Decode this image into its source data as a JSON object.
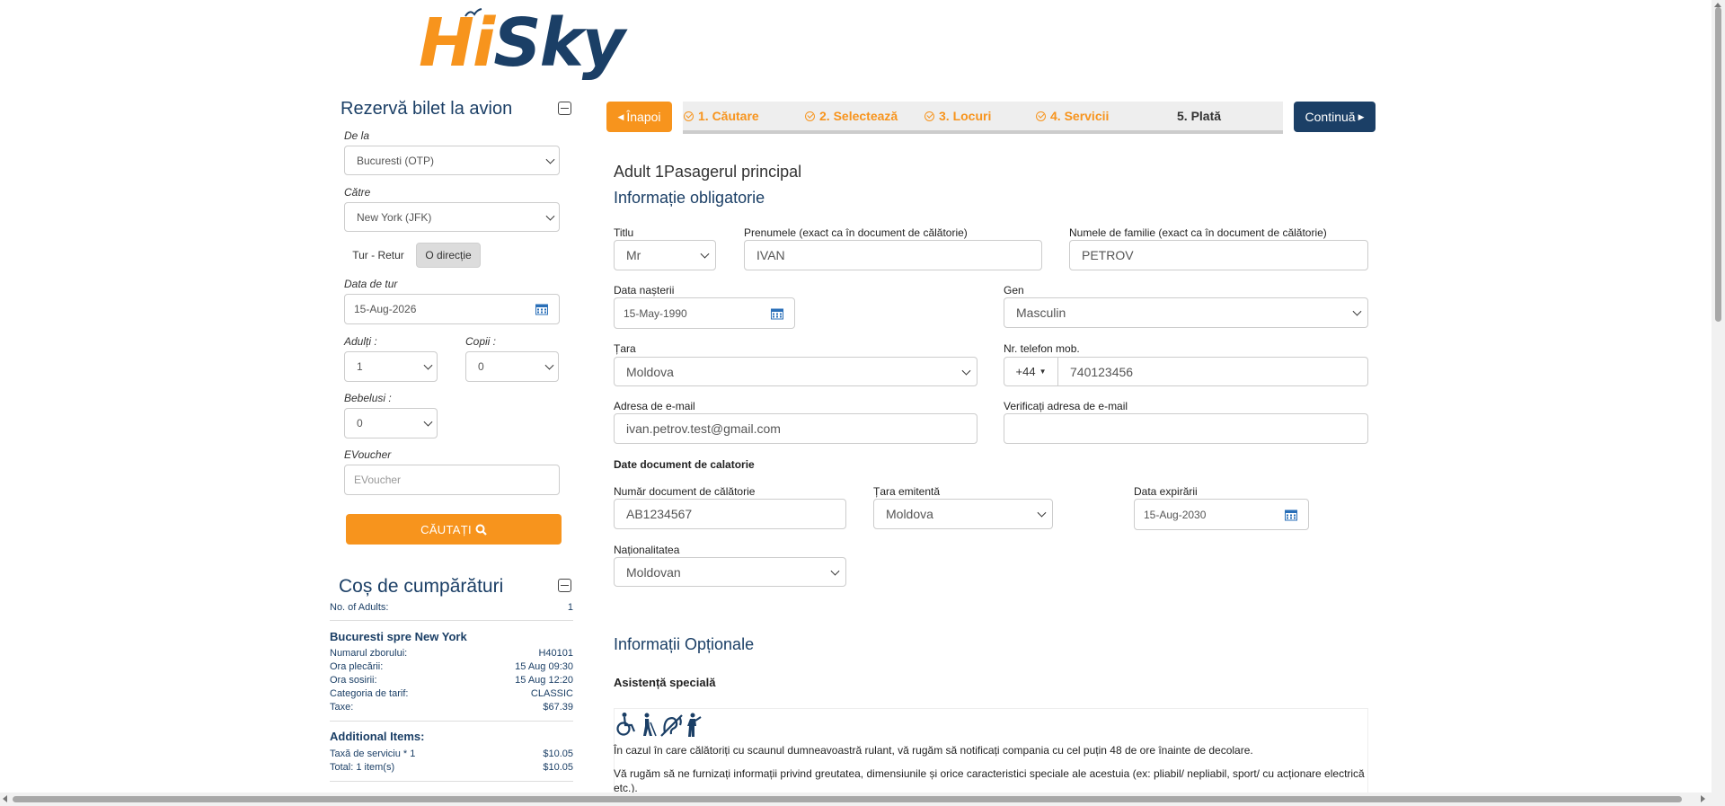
{
  "logo": {
    "part1": "Hi",
    "part2": "Sky"
  },
  "booking": {
    "title": "Rezervă bilet la avion",
    "from_label": "De la",
    "from_value": "Bucuresti (OTP)",
    "to_label": "Către",
    "to_value": "New York (JFK)",
    "trip_round": "Tur - Retur",
    "trip_oneway": "O direcție",
    "date_label": "Data de tur",
    "date_value": "15-Aug-2026",
    "adults_label": "Adulți :",
    "adults_value": "1",
    "children_label": "Copii :",
    "children_value": "0",
    "infants_label": "Bebelusi :",
    "infants_value": "0",
    "evoucher_label": "EVoucher",
    "evoucher_placeholder": "EVoucher",
    "search_button": "CĂUTAȚI"
  },
  "cart": {
    "title": "Coș de cumpărături",
    "adults_label": "No. of Adults:",
    "adults_value": "1",
    "route": "Bucuresti spre New York",
    "rows": [
      {
        "label": "Numarul zborului:",
        "value": "H40101"
      },
      {
        "label": "Ora plecării:",
        "value": "15 Aug 09:30"
      },
      {
        "label": "Ora sosirii:",
        "value": "15 Aug 12:20"
      },
      {
        "label": "Categoria de tarif:",
        "value": "CLASSIC"
      },
      {
        "label": "Taxe:",
        "value": "$67.39"
      }
    ],
    "additional_title": "Additional Items:",
    "additional_rows": [
      {
        "label": "Taxă de serviciu * 1",
        "value": "$10.05"
      },
      {
        "label": "Total: 1 item(s)",
        "value": "$10.05"
      }
    ]
  },
  "steps": {
    "back": "Înapoi",
    "items": [
      "1. Căutare",
      "2. Selectează",
      "3. Locuri",
      "4. Servicii",
      "5. Plată"
    ],
    "next": "Continuă"
  },
  "form": {
    "passenger_heading": "Adult 1Pasagerul principal",
    "mandatory_heading": "Informație obligatorie",
    "title_label": "Titlu",
    "title_value": "Mr",
    "firstname_label": "Prenumele (exact ca în document de călătorie)",
    "firstname_value": "IVAN",
    "lastname_label": "Numele de familie (exact ca în document de călătorie)",
    "lastname_value": "PETROV",
    "dob_label": "Data nașterii",
    "dob_value": "15-May-1990",
    "gender_label": "Gen",
    "gender_value": "Masculin",
    "country_label": "Țara",
    "country_value": "Moldova",
    "phone_label": "Nr. telefon mob.",
    "phone_prefix": "+44",
    "phone_value": "740123456",
    "email_label": "Adresa de e-mail",
    "email_value": "ivan.petrov.test@gmail.com",
    "email_verify_label": "Verificați adresa de e-mail",
    "doc_section": "Date document de calatorie",
    "doc_number_label": "Număr document de călătorie",
    "doc_number_value": "AB1234567",
    "issuing_country_label": "Țara emitentă",
    "issuing_country_value": "Moldova",
    "expiry_label": "Data expirării",
    "expiry_value": "15-Aug-2030",
    "nationality_label": "Naționalitatea",
    "nationality_value": "Moldovan",
    "optional_heading": "Informații Opționale",
    "special_assistance": "Asistență specială",
    "assist_text_1": "În cazul în care călătoriți cu scaunul dumneavoastră rulant, vă rugăm să notificați compania cu cel puțin 48 de ore înainte de decolare.",
    "assist_text_2": "Vă rugăm să ne furnizați informații privind greutatea, dimensiunile și orice caracteristici speciale ale acestuia (ex: pliabil/ nepliabil, sport/ cu acționare electrică etc.)."
  },
  "colors": {
    "orange": "#f7941d",
    "navy": "#1b3f66"
  }
}
